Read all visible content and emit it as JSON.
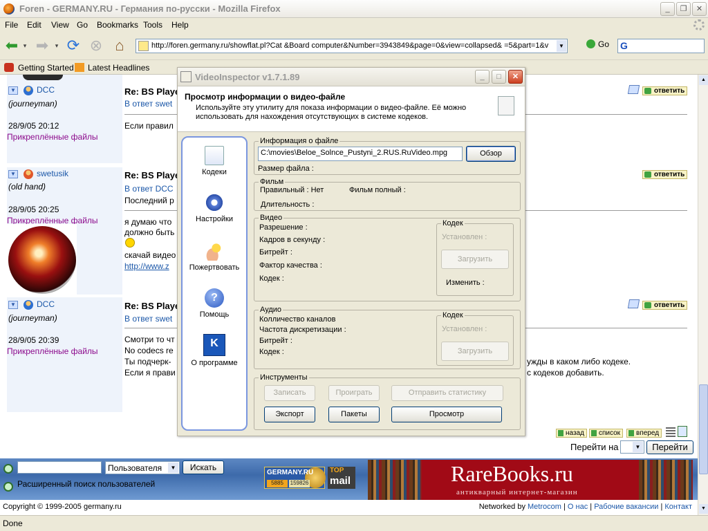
{
  "browser": {
    "title": "Foren - GERMANY.RU - Германия по-русски - Mozilla Firefox",
    "menu": [
      "File",
      "Edit",
      "View",
      "Go",
      "Bookmarks",
      "Tools",
      "Help"
    ],
    "url": "http://foren.germany.ru/showflat.pl?Cat  &Board  computer&Number=3943849&page=0&view=collapsed&   =5&part=1&v",
    "go_label": "Go",
    "search_engine": "G",
    "bookmarks": [
      "Getting Started",
      "Latest Headlines"
    ],
    "status": "Done",
    "colors": {
      "chrome": "#ece9d8",
      "link": "#1b57a8",
      "files": "#8c0a8c"
    }
  },
  "forum": {
    "posts": [
      {
        "user": "DCC",
        "rank": "(journeyman)",
        "time": "28/9/05 20:12",
        "files": "Прикреплённые файлы",
        "subject": "Re: BS Playe",
        "reply": "В ответ swet",
        "body": [
          "Если правил"
        ]
      },
      {
        "user": "swetusik",
        "rank": "(old hand)",
        "time": "28/9/05 20:25",
        "files": "Прикреплённые файлы",
        "subject": "Re: BS Playe",
        "reply": "В ответ DCC",
        "body": [
          "Последний р",
          "я думаю что",
          "должно быть",
          "скачай видео",
          "http://www.z"
        ]
      },
      {
        "user": "DCC",
        "rank": "(journeyman)",
        "time": "28/9/05 20:39",
        "files": "Прикреплённые файлы",
        "subject": "Re: BS Playe",
        "reply": "В ответ swet",
        "body": [
          "Смотри то чт",
          "No codecs re",
          "Ты подчерк-",
          "Если я прави"
        ],
        "body_right": [
          "ужды в каком либо кодеке.",
          "с кодеков добавить."
        ]
      }
    ],
    "answer_label": "ответить",
    "pager": {
      "back": "назад",
      "list": "список",
      "forward": "вперед"
    },
    "goto_label": "Перейти на",
    "goto_button": "Перейти",
    "search": {
      "type_value": "Пользователя",
      "button": "Искать",
      "advanced": "Расширенный поиск пользователей"
    },
    "banner": {
      "germany": "GERMANY.RU",
      "germany_c1": "5885",
      "germany_c2": "159826",
      "top": "TOP",
      "mail": "mail",
      "rarebooks": "RareBooks.ru",
      "rarebooks_sub": "антикварный интернет-магазин"
    },
    "copyright": "Copyright © 1999-2005 germany.ru",
    "networked_prefix": "Networked by",
    "footer_links": [
      "Metrocom",
      "О нас",
      "Рабочие вакансии",
      "Контакт"
    ]
  },
  "videoinspector": {
    "title": "VideoInspector v1.7.1.89",
    "header_title": "Просмотр информации о видео-файле",
    "header_desc": "Используйте эту утилиту для показа информации о видео-файле. Её можно использовать для нахождения отсутствующих в системе кодеков.",
    "sidebar": [
      "Кодеки",
      "Настройки",
      "Пожертвовать",
      "Помощь",
      "О программе"
    ],
    "file_group": "Информация о файле",
    "file_path": "C:\\movies\\Beloe_Solnce_Pustyni_2.RUS.RuVideo.mpg",
    "browse": "Обзор",
    "file_size": "Размер файла :",
    "film_group": "Фильм",
    "film_valid": "Правильный : Нет",
    "film_full": "Фильм полный :",
    "film_duration": "Длительность :",
    "video_group": "Видео",
    "video_fields": [
      "Разрешение :",
      "Кадров в секунду :",
      "Битрейт :",
      "Фактор качества :",
      "Кодек :"
    ],
    "codec_group": "Кодек",
    "installed": "Установлен :",
    "load": "Загрузить",
    "change": "Изменить :",
    "audio_group": "Аудио",
    "audio_fields": [
      "Колличество каналов",
      "Частота дискретизации :",
      "Битрейт :",
      "Кодек :"
    ],
    "tools_group": "Инструменты",
    "tools": [
      "Записать",
      "Проиграть",
      "Отправить статистику",
      "Экспорт",
      "Пакеты",
      "Просмотр"
    ]
  }
}
